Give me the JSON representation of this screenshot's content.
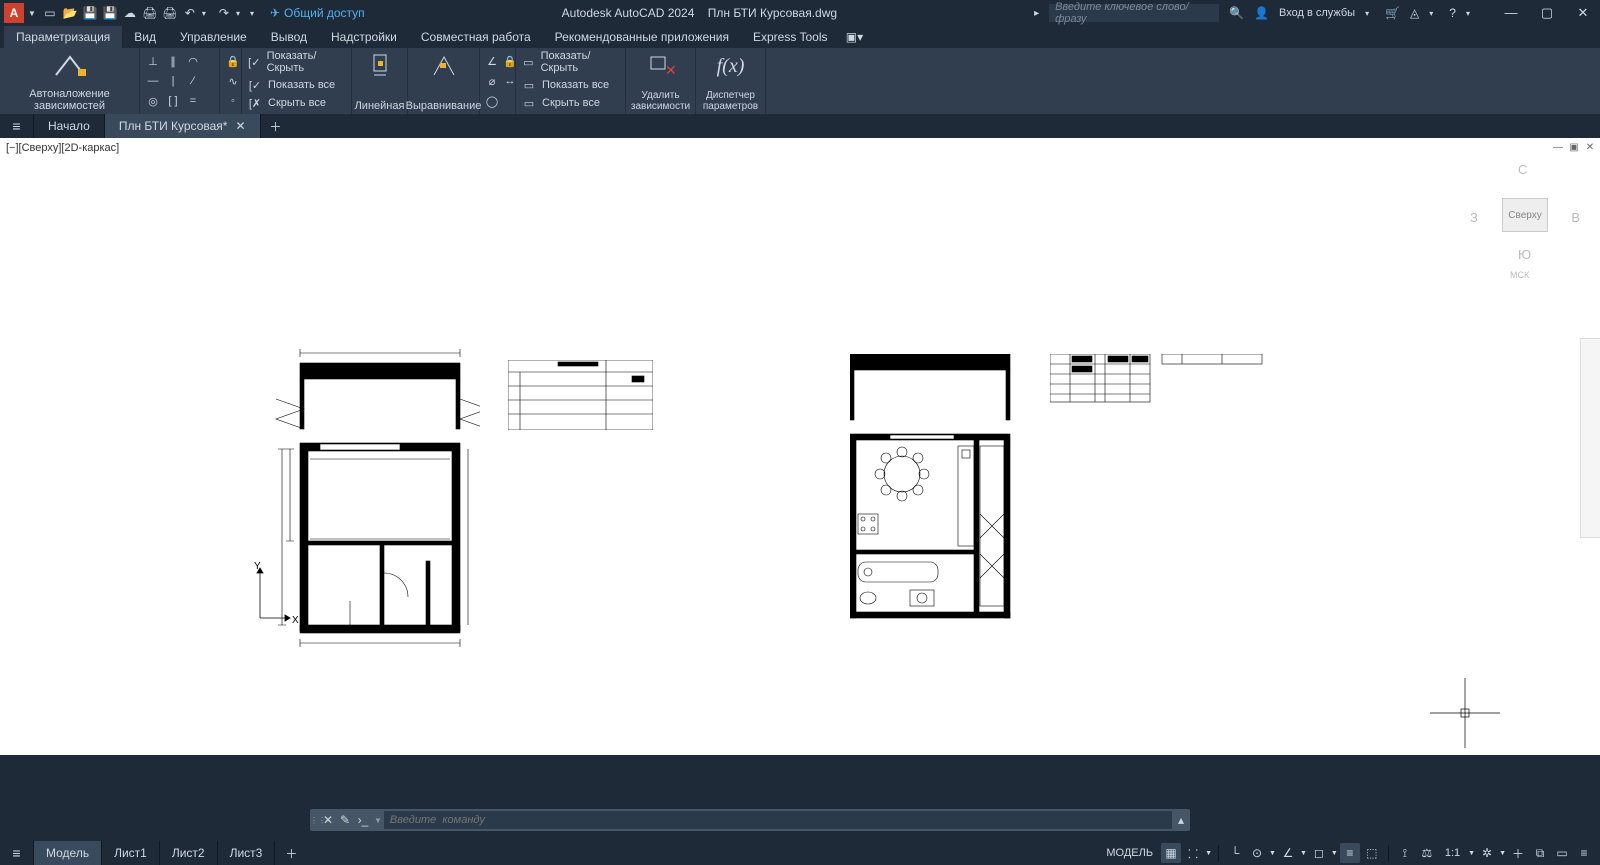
{
  "app": {
    "letter": "A",
    "product": "Autodesk AutoCAD 2024",
    "filename": "Плн БТИ Курсовая.dwg"
  },
  "qat_icons": [
    "new",
    "open",
    "save",
    "saveas",
    "web",
    "plot",
    "print",
    "undo",
    "redo"
  ],
  "share": {
    "label": "Общий доступ"
  },
  "search": {
    "placeholder": "Введите ключевое слово/фразу"
  },
  "account": {
    "label": "Вход в службы"
  },
  "ribbon_tabs": [
    "Параметризация",
    "Вид",
    "Управление",
    "Вывод",
    "Надстройки",
    "Совместная работа",
    "Рекомендованные приложения",
    "Express Tools"
  ],
  "ribbon_active": 0,
  "panels": {
    "auto": "Автоналожение зависимостей",
    "show_hide": "Показать/Скрыть",
    "show_all": "Показать все",
    "hide_all": "Скрыть все",
    "linear": "Линейная",
    "align": "Выравнивание",
    "delete": "Удалить зависимости",
    "manager": "Диспетчер параметров"
  },
  "doc_tabs": {
    "start": "Начало",
    "file": "Плн БТИ Курсовая*"
  },
  "viewport": {
    "label": "[−][Сверху][2D-каркас]"
  },
  "viewcube": {
    "n": "С",
    "s": "Ю",
    "w": "З",
    "e": "В",
    "top": "Сверху",
    "mck": "МСК"
  },
  "axes": {
    "x": "X",
    "y": "Y"
  },
  "command": {
    "placeholder": "Введите  команду"
  },
  "layout_tabs": [
    "Модель",
    "Лист1",
    "Лист2",
    "Лист3"
  ],
  "layout_active": 0,
  "status": {
    "model": "МОДЕЛЬ",
    "scale": "1:1"
  }
}
